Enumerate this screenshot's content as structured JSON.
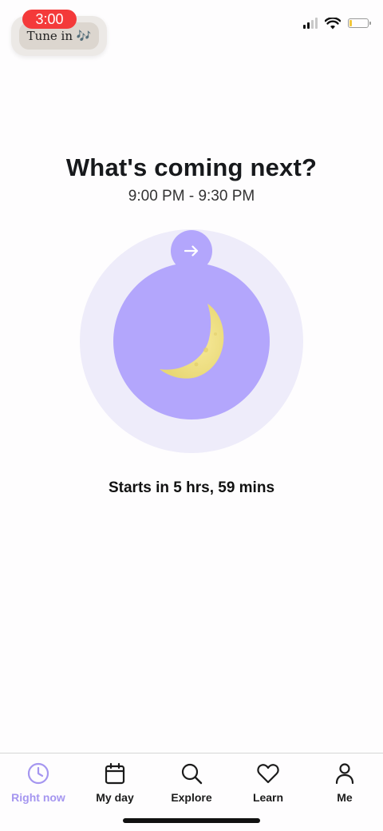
{
  "status_bar": {
    "time": "3:00",
    "tune_in": "Tune in 🎶"
  },
  "main": {
    "title": "What's coming next?",
    "time_range": "9:00 PM - 9:30 PM",
    "countdown": "Starts in 5 hrs, 59 mins",
    "icon": "crescent-moon-icon"
  },
  "tabs": [
    {
      "label": "Right now",
      "icon": "clock-icon",
      "active": true
    },
    {
      "label": "My day",
      "icon": "calendar-icon",
      "active": false
    },
    {
      "label": "Explore",
      "icon": "search-icon",
      "active": false
    },
    {
      "label": "Learn",
      "icon": "heart-icon",
      "active": false
    },
    {
      "label": "Me",
      "icon": "person-icon",
      "active": false
    }
  ],
  "colors": {
    "accent": "#b3a6fc",
    "accent_light": "#eeecfa",
    "active_tab": "#a596f0",
    "recording_pill": "#f43a3a",
    "moon": "#f4e58c"
  }
}
